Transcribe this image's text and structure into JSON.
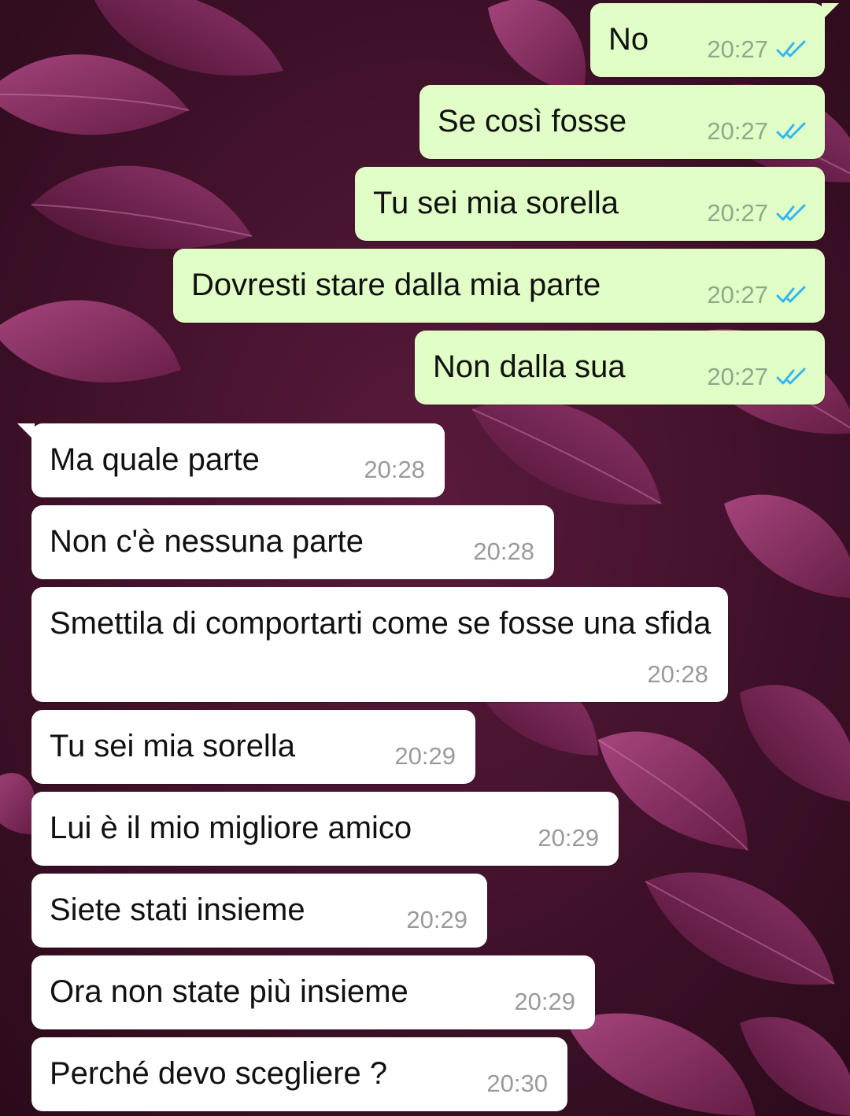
{
  "theme": {
    "outgoing_bubble": "#e1fec6",
    "incoming_bubble": "#ffffff",
    "read_tick_color": "#34b7f1",
    "wallpaper": "purple leaves"
  },
  "messages": [
    {
      "direction": "out",
      "text": "No",
      "time": "20:27",
      "status": "read",
      "status_icon": "double-check-icon"
    },
    {
      "direction": "out",
      "text": "Se così fosse",
      "time": "20:27",
      "status": "read",
      "status_icon": "double-check-icon"
    },
    {
      "direction": "out",
      "text": "Tu sei mia sorella",
      "time": "20:27",
      "status": "read",
      "status_icon": "double-check-icon"
    },
    {
      "direction": "out",
      "text": "Dovresti stare dalla mia parte",
      "time": "20:27",
      "status": "read",
      "status_icon": "double-check-icon"
    },
    {
      "direction": "out",
      "text": "Non dalla sua",
      "time": "20:27",
      "status": "read",
      "status_icon": "double-check-icon"
    },
    {
      "direction": "in",
      "text": "Ma quale parte",
      "time": "20:28"
    },
    {
      "direction": "in",
      "text": "Non c'è nessuna parte",
      "time": "20:28"
    },
    {
      "direction": "in",
      "text": "Smettila di comportarti come se fosse una sfida",
      "time": "20:28"
    },
    {
      "direction": "in",
      "text": "Tu sei mia sorella",
      "time": "20:29"
    },
    {
      "direction": "in",
      "text": "Lui è il mio migliore amico",
      "time": "20:29"
    },
    {
      "direction": "in",
      "text": "Siete stati insieme",
      "time": "20:29"
    },
    {
      "direction": "in",
      "text": "Ora non state più insieme",
      "time": "20:29"
    },
    {
      "direction": "in",
      "text": "Perché devo scegliere ?",
      "time": "20:30"
    }
  ]
}
